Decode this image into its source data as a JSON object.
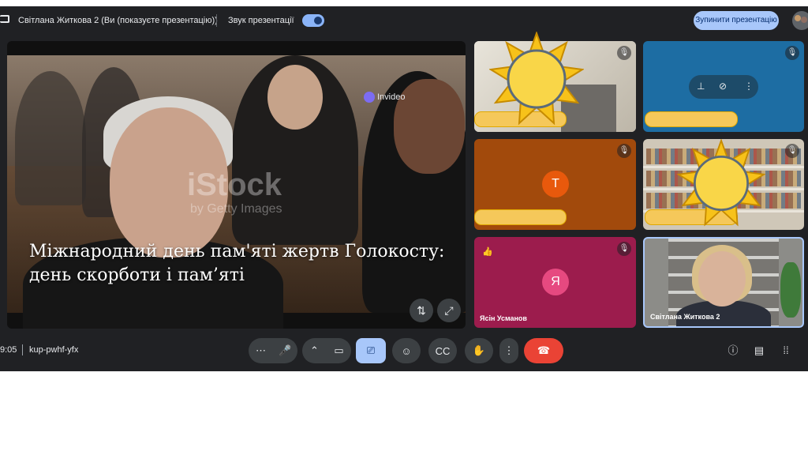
{
  "topbar": {
    "presenter": "Світлана Житкова 2 (Ви (показуєте презентацію))",
    "sound_label": "Звук презентації",
    "stop_button": "Зупинити презентацію"
  },
  "presentation": {
    "caption": "Міжнародний день пам'яті жертв Голокосту: день скорботи і пам’яті",
    "watermark": "iStock",
    "watermark_sub": "by Getty Images",
    "logo": "Invideo"
  },
  "participants": [
    {
      "letter": "",
      "name": "",
      "bg": "#d7d4cb",
      "muted": true
    },
    {
      "letter": "",
      "name": "",
      "bg": "#1d6da3",
      "muted": true
    },
    {
      "letter": "T",
      "name": "",
      "bg": "#a24a0c",
      "avatar_color": "#e8590c",
      "muted": true
    },
    {
      "letter": "",
      "name": "",
      "bg": "#cfc7b8",
      "muted": true
    },
    {
      "letter": "Я",
      "name": "Ясін Усманов",
      "bg": "#9c1c4d",
      "avatar_color": "#e64980",
      "muted": true
    },
    {
      "letter": "",
      "name": "Світлана Житкова 2",
      "bg": "#8c8c88",
      "muted": false
    }
  ],
  "meeting": {
    "time": "9:05",
    "code": "kup-pwhf-yfx"
  },
  "icons": [
    "present-icon",
    "mic-icon",
    "camera-icon",
    "present-now-icon",
    "emoji-icon",
    "captions-icon",
    "raise-hand-icon",
    "more-options-icon",
    "end-call-icon",
    "info-icon",
    "chat-icon",
    "activities-icon",
    "pin-icon",
    "remove-icon",
    "sun-sticker-icon"
  ],
  "colors": {
    "background": "#202124",
    "accent": "#a8c7fa",
    "end_call": "#ea4335",
    "sticker": "#f5c85a"
  }
}
